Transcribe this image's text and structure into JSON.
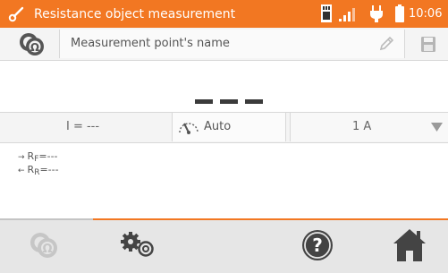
{
  "title_bar": {
    "title": "Resistance object measurement",
    "time": "10:06",
    "icons": [
      "probe-icon",
      "memory-card-icon",
      "signal-icon",
      "power-plug-icon",
      "battery-icon"
    ]
  },
  "name_row": {
    "placeholder": "Measurement point's name",
    "icons": [
      "ohm-icon",
      "pencil-icon",
      "save-icon"
    ]
  },
  "result": {
    "main_value": "— — —"
  },
  "params": {
    "current_label": "I = ---",
    "range_mode": "Auto",
    "current_select": "1 A"
  },
  "results": {
    "rf_prefix": "R",
    "rf_sub": "F",
    "rf_value": "=---",
    "rr_prefix": "R",
    "rr_sub": "R",
    "rr_value": "=---"
  },
  "toolbar": {
    "icons": [
      "ohm-icon",
      "settings-icon",
      "help-icon",
      "home-icon"
    ]
  },
  "colors": {
    "accent": "#f27722",
    "bar_bg": "#e6e6e6",
    "dark_icon": "#444444",
    "disabled_icon": "#c6c6c6"
  }
}
